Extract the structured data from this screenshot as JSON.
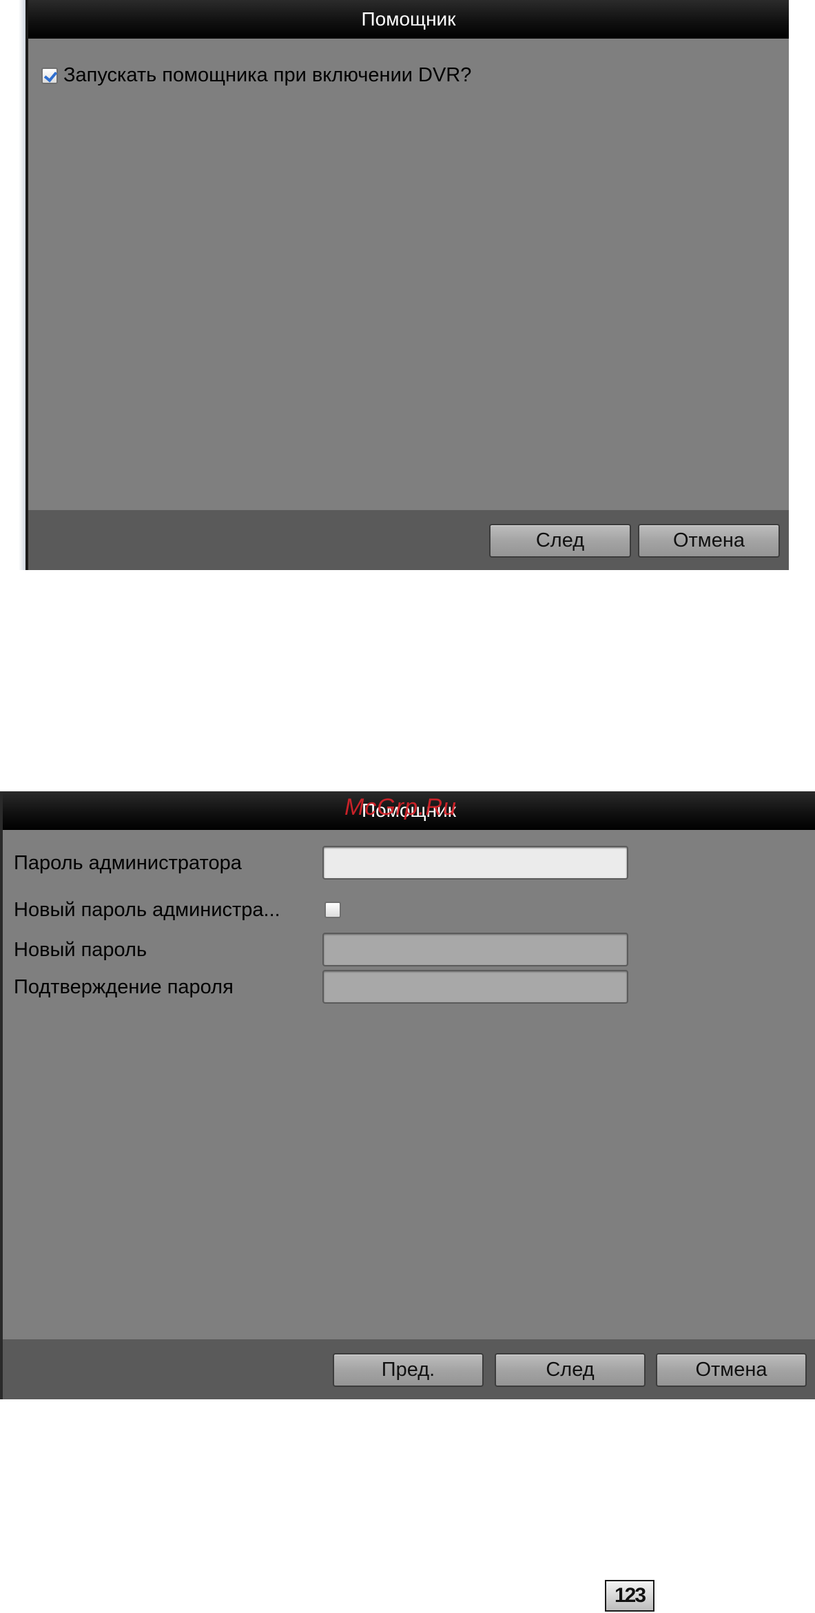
{
  "dialog1": {
    "title": "Помощник",
    "startup_checkbox": {
      "label": "Запускать помощника при включении DVR?",
      "checked": true
    },
    "buttons": {
      "next": "След",
      "cancel": "Отмена"
    }
  },
  "dialog2": {
    "title": "Помощник",
    "fields": {
      "admin_password": {
        "label": "Пароль администратора",
        "value": "",
        "enabled": true
      },
      "new_admin_password": {
        "label": "Новый пароль администра...",
        "checked": false
      },
      "new_password": {
        "label": "Новый пароль",
        "value": "",
        "enabled": false
      },
      "confirm_password": {
        "label": "Подтверждение пароля",
        "value": "",
        "enabled": false
      }
    },
    "buttons": {
      "prev": "Пред.",
      "next": "След",
      "cancel": "Отмена"
    }
  },
  "watermark": "McGrp.Ru",
  "icon_123": {
    "icon": "numeric-input-icon",
    "text": "123"
  },
  "colors": {
    "dialog_bg": "#7f7f7f",
    "footer_bg": "#5a5a5a",
    "titlebar_bg": "#000000",
    "checkbox_check": "#2f6fd0",
    "watermark": "#d8232a"
  }
}
